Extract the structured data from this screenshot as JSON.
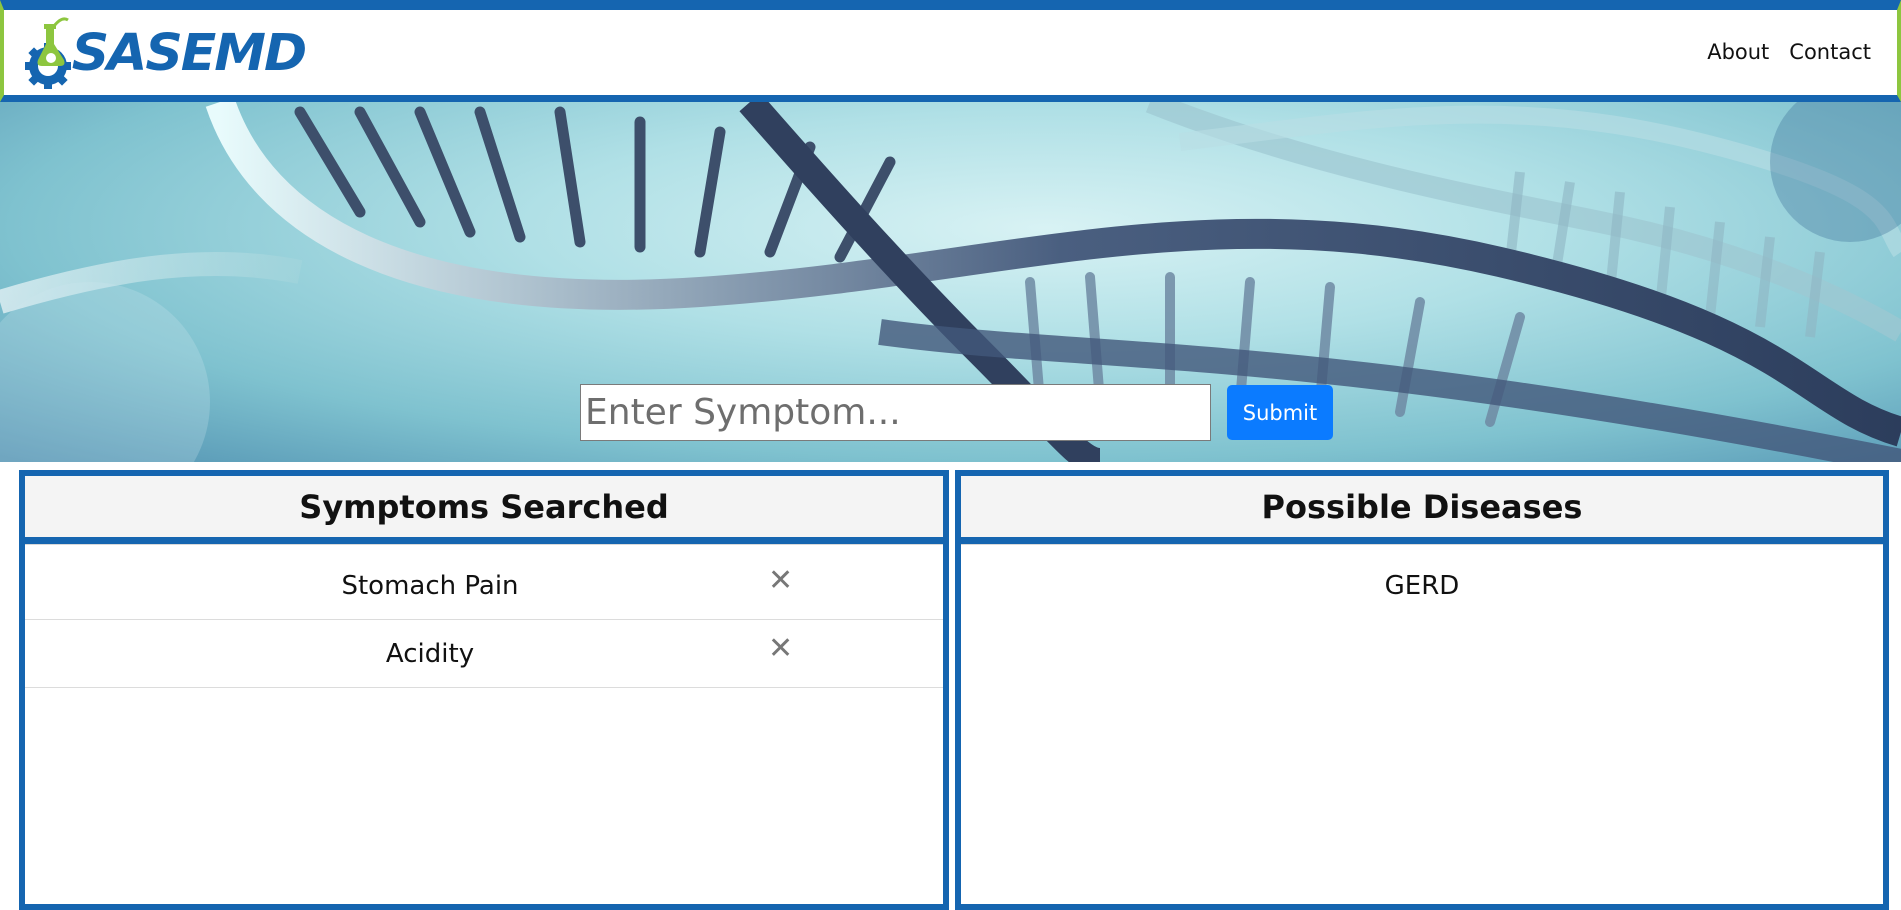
{
  "header": {
    "logo_text": "SASEMD",
    "nav": [
      {
        "label": "About"
      },
      {
        "label": "Contact"
      }
    ]
  },
  "hero": {
    "search": {
      "placeholder": "Enter Symptom...",
      "value": ""
    },
    "submit_label": "Submit"
  },
  "symptoms_panel": {
    "title": "Symptoms Searched",
    "items": [
      {
        "label": "Stomach Pain",
        "remove_icon": "close-icon"
      },
      {
        "label": "Acidity",
        "remove_icon": "close-icon"
      }
    ]
  },
  "diseases_panel": {
    "title": "Possible Diseases",
    "items": [
      {
        "label": "GERD"
      }
    ]
  },
  "colors": {
    "brand_blue": "#1565b0",
    "brand_green": "#8dc63f",
    "submit_blue": "#0b7bff"
  }
}
